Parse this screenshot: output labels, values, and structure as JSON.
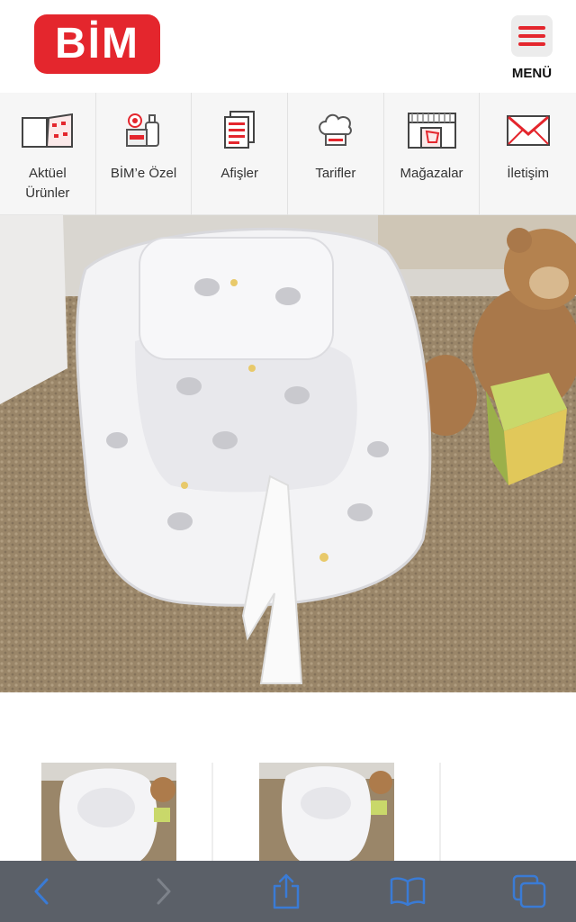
{
  "header": {
    "logo_text": "BİM",
    "menu_label": "MENÜ"
  },
  "nav": {
    "items": [
      {
        "line1": "Aktüel",
        "line2": "Ürünler",
        "icon": "catalog-icon"
      },
      {
        "line1": "BİM’e Özel",
        "line2": "",
        "icon": "products-icon"
      },
      {
        "line1": "Afişler",
        "line2": "",
        "icon": "posters-icon"
      },
      {
        "line1": "Tarifler",
        "line2": "",
        "icon": "chef-hat-icon"
      },
      {
        "line1": "Mağazalar",
        "line2": "",
        "icon": "store-icon"
      },
      {
        "line1": "İletişim",
        "line2": "",
        "icon": "envelope-icon"
      }
    ]
  },
  "colors": {
    "brand_red": "#e4262d",
    "toolbar_bg": "#5b6068",
    "toolbar_icon": "#3a7bd5"
  },
  "toolbar": {
    "buttons": [
      "back-icon",
      "forward-icon",
      "share-icon",
      "bookmarks-icon",
      "tabs-icon"
    ]
  }
}
